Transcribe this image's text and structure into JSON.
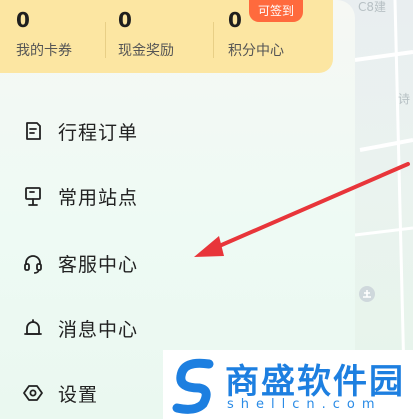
{
  "stats": {
    "coupons": {
      "value": "0",
      "label": "我的卡券"
    },
    "cash": {
      "value": "0",
      "label": "现金奖励"
    },
    "points": {
      "value": "0",
      "label": "积分中心",
      "badge": "可签到"
    }
  },
  "menu": [
    {
      "label": "行程订单",
      "icon": "order-list-icon"
    },
    {
      "label": "常用站点",
      "icon": "station-sign-icon"
    },
    {
      "label": "客服中心",
      "icon": "headset-icon"
    },
    {
      "label": "消息中心",
      "icon": "bell-icon"
    },
    {
      "label": "设置",
      "icon": "settings-hexagon-icon"
    }
  ],
  "map": {
    "labels": [
      "C8建",
      "诗"
    ]
  },
  "watermark": {
    "title": "商盛软件园",
    "url": "shellcn.com"
  },
  "colors": {
    "stats_bg": "#fce6a2",
    "badge_bg": "#ff6a3d",
    "arrow": "#e8353a",
    "watermark_blue": "#1d7fe0"
  }
}
